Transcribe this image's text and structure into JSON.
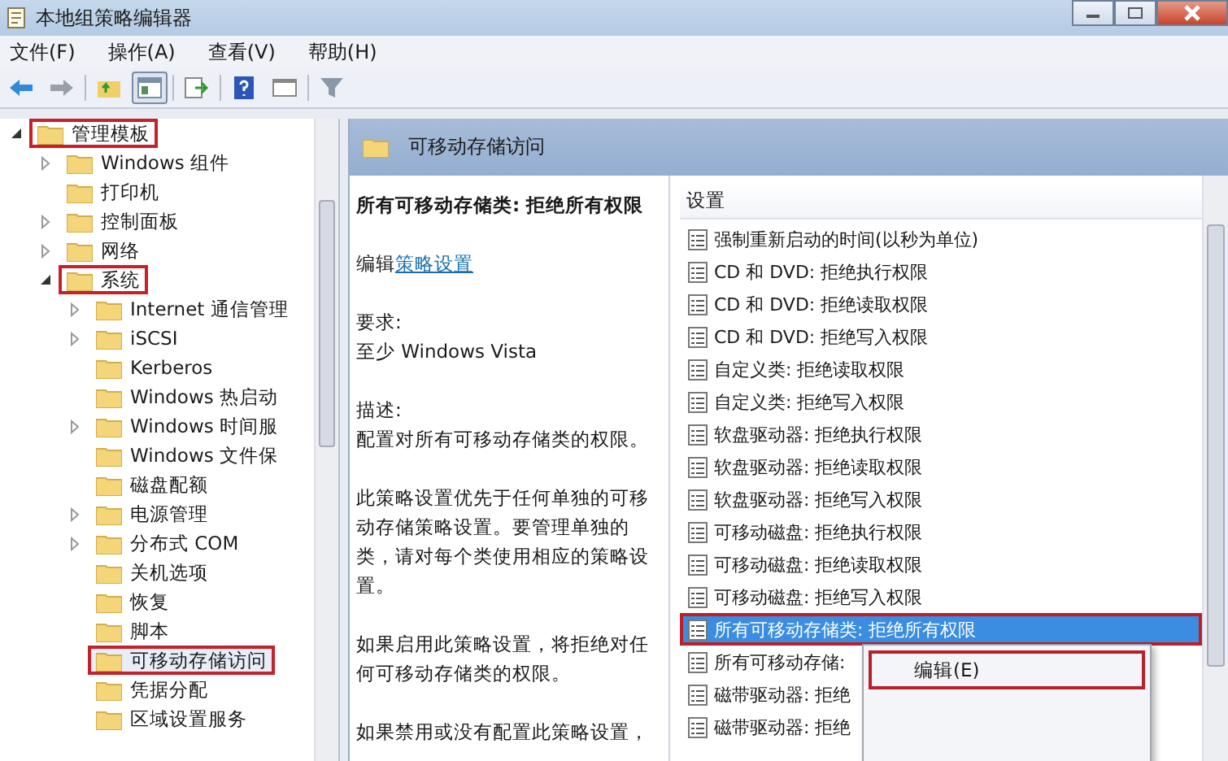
{
  "window": {
    "title": "本地组策略编辑器"
  },
  "menu_bar": [
    "文件(F)",
    "操作(A)",
    "查看(V)",
    "帮助(H)"
  ],
  "toolbar": [
    {
      "kind": "back",
      "pressed": false
    },
    {
      "kind": "forward",
      "pressed": false
    },
    {
      "kind": "separator"
    },
    {
      "kind": "folder-up",
      "pressed": false
    },
    {
      "kind": "tree-toggle",
      "pressed": true
    },
    {
      "kind": "separator"
    },
    {
      "kind": "export",
      "pressed": false
    },
    {
      "kind": "separator"
    },
    {
      "kind": "help",
      "pressed": false
    },
    {
      "kind": "panel",
      "pressed": false
    },
    {
      "kind": "separator"
    },
    {
      "kind": "filter",
      "pressed": false
    }
  ],
  "tree": [
    {
      "label": "管理模板",
      "expanded": true,
      "highlighted": true,
      "selected": false,
      "children": [
        {
          "label": "Windows 组件",
          "expanded": false,
          "highlighted": false,
          "selected": false
        },
        {
          "label": "打印机",
          "highlighted": false,
          "selected": false
        },
        {
          "label": "控制面板",
          "expanded": false,
          "highlighted": false,
          "selected": false
        },
        {
          "label": "网络",
          "expanded": false,
          "highlighted": false,
          "selected": false
        },
        {
          "label": "系统",
          "expanded": true,
          "highlighted": true,
          "selected": false,
          "children": [
            {
              "label": "Internet 通信管理",
              "expanded": false,
              "highlighted": false,
              "selected": false
            },
            {
              "label": "iSCSI",
              "expanded": false,
              "highlighted": false,
              "selected": false
            },
            {
              "label": "Kerberos",
              "highlighted": false,
              "selected": false
            },
            {
              "label": "Windows 热启动",
              "highlighted": false,
              "selected": false
            },
            {
              "label": "Windows 时间服",
              "expanded": false,
              "highlighted": false,
              "selected": false
            },
            {
              "label": "Windows 文件保",
              "highlighted": false,
              "selected": false
            },
            {
              "label": "磁盘配额",
              "highlighted": false,
              "selected": false
            },
            {
              "label": "电源管理",
              "expanded": false,
              "highlighted": false,
              "selected": false
            },
            {
              "label": "分布式 COM",
              "expanded": false,
              "highlighted": false,
              "selected": false
            },
            {
              "label": "关机选项",
              "highlighted": false,
              "selected": false
            },
            {
              "label": "恢复",
              "highlighted": false,
              "selected": false
            },
            {
              "label": "脚本",
              "highlighted": false,
              "selected": false
            },
            {
              "label": "可移动存储访问",
              "highlighted": true,
              "selected": true
            },
            {
              "label": "凭据分配",
              "highlighted": false,
              "selected": false
            },
            {
              "label": "区域设置服务",
              "highlighted": false,
              "selected": false
            }
          ]
        }
      ]
    }
  ],
  "detail_pane": {
    "header": "可移动存储访问",
    "policy_title": "所有可移动存储类: 拒绝所有权限",
    "edit_prefix": "编辑",
    "edit_link": "策略设置",
    "requirement_label": "要求:",
    "requirement": "至少 Windows Vista",
    "description_label": "描述:",
    "paragraphs": [
      "配置对所有可移动存储类的权限。",
      "此策略设置优先于任何单独的可移动存储策略设置。要管理单独的类，请对每个类使用相应的策略设置。",
      "如果启用此策略设置，将拒绝对任何可移动存储类的权限。",
      "如果禁用或没有配置此策略设置，"
    ]
  },
  "settings_list": {
    "column": "设置",
    "rows": [
      {
        "label": "强制重新启动的时间(以秒为单位)",
        "selected": false,
        "highlighted": false
      },
      {
        "label": "CD 和 DVD: 拒绝执行权限",
        "selected": false,
        "highlighted": false
      },
      {
        "label": "CD 和 DVD: 拒绝读取权限",
        "selected": false,
        "highlighted": false
      },
      {
        "label": "CD 和 DVD: 拒绝写入权限",
        "selected": false,
        "highlighted": false
      },
      {
        "label": "自定义类: 拒绝读取权限",
        "selected": false,
        "highlighted": false
      },
      {
        "label": "自定义类: 拒绝写入权限",
        "selected": false,
        "highlighted": false
      },
      {
        "label": "软盘驱动器: 拒绝执行权限",
        "selected": false,
        "highlighted": false
      },
      {
        "label": "软盘驱动器: 拒绝读取权限",
        "selected": false,
        "highlighted": false
      },
      {
        "label": "软盘驱动器: 拒绝写入权限",
        "selected": false,
        "highlighted": false
      },
      {
        "label": "可移动磁盘: 拒绝执行权限",
        "selected": false,
        "highlighted": false
      },
      {
        "label": "可移动磁盘: 拒绝读取权限",
        "selected": false,
        "highlighted": false
      },
      {
        "label": "可移动磁盘: 拒绝写入权限",
        "selected": false,
        "highlighted": false
      },
      {
        "label": "所有可移动存储类: 拒绝所有权限",
        "selected": true,
        "highlighted": true
      },
      {
        "label": "所有可移动存储:",
        "selected": false,
        "highlighted": false
      },
      {
        "label": "磁带驱动器: 拒绝",
        "selected": false,
        "highlighted": false
      },
      {
        "label": "磁带驱动器: 拒绝",
        "selected": false,
        "highlighted": false
      }
    ]
  },
  "context_menu": {
    "items": [
      {
        "label": "编辑(E)",
        "highlighted": true
      }
    ]
  }
}
